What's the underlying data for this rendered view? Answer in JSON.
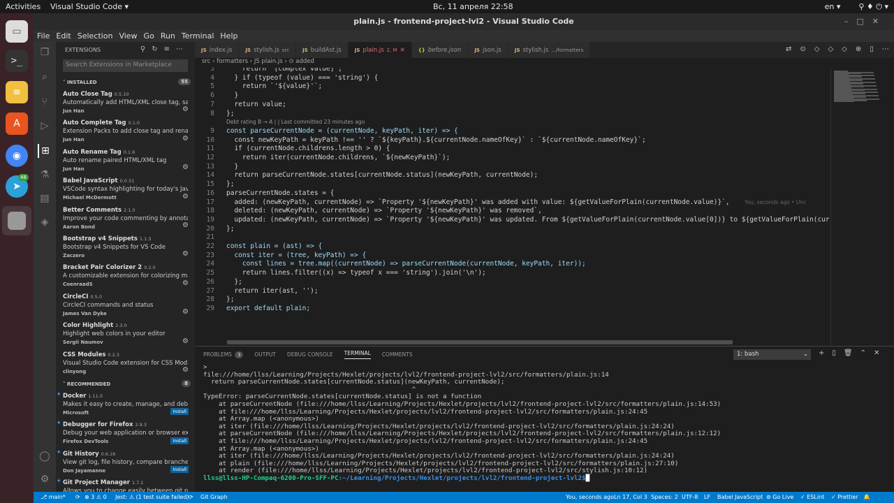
{
  "topbar": {
    "activities": "Activities",
    "app": "Visual Studio Code ▾",
    "clock": "Вс, 11 апреля  22:58",
    "lang": "en ▾",
    "sys": "⚲  ♦  ⏻ ▾"
  },
  "window": {
    "title": "plain.js - frontend-project-lvl2 - Visual Studio Code"
  },
  "menu": [
    "File",
    "Edit",
    "Selection",
    "View",
    "Go",
    "Run",
    "Terminal",
    "Help"
  ],
  "sidebar": {
    "header": "EXTENSIONS",
    "search_placeholder": "Search Extensions in Marketplace",
    "installed_label": "INSTALLED",
    "installed_count": "55",
    "recommended_label": "RECOMMENDED",
    "recommended_count": "8",
    "installed": [
      {
        "name": "Auto Close Tag",
        "version": "0.5.10",
        "desc": "Automatically add HTML/XML close tag, sa...",
        "author": "Jun Han"
      },
      {
        "name": "Auto Complete Tag",
        "version": "0.1.0",
        "desc": "Extension Packs to add close tag and renam...",
        "author": "Jun Han"
      },
      {
        "name": "Auto Rename Tag",
        "version": "0.1.6",
        "desc": "Auto rename paired HTML/XML tag",
        "author": "Jun Han"
      },
      {
        "name": "Babel JavaScript",
        "version": "0.0.31",
        "desc": "VSCode syntax highlighting for today's Java...",
        "author": "Michael McDermott"
      },
      {
        "name": "Better Comments",
        "version": "2.1.0",
        "desc": "Improve your code commenting by annotati...",
        "author": "Aaron Bond"
      },
      {
        "name": "Bootstrap v4 Snippets",
        "version": "1.1.3",
        "desc": "Bootstrap v4 Snippets for VS Code",
        "author": "Zaczero"
      },
      {
        "name": "Bracket Pair Colorizer 2",
        "version": "0.2.0",
        "desc": "A customizable extension for colorizing ma...",
        "author": "CoenraadS"
      },
      {
        "name": "CircleCI",
        "version": "0.5.0",
        "desc": "CircleCI commands and status",
        "author": "James Van Dyke"
      },
      {
        "name": "Color Highlight",
        "version": "2.3.0",
        "desc": "Highlight web colors in your editor",
        "author": "Sergii Naumov"
      },
      {
        "name": "CSS Modules",
        "version": "0.2.3",
        "desc": "Visual Studio Code extension for CSS Modu...",
        "author": "clinyong"
      }
    ],
    "recommended": [
      {
        "name": "Docker",
        "version": "1.11.0",
        "desc": "Makes it easy to create, manage, and debug...",
        "author": "Microsoft",
        "install": "Install"
      },
      {
        "name": "Debugger for Firefox",
        "version": "2.9.3",
        "desc": "Debug your web application or browser ext...",
        "author": "Firefox DevTools",
        "install": "Install"
      },
      {
        "name": "Git History",
        "version": "0.6.16",
        "desc": "View git log, file history, compare branches ...",
        "author": "Don Jayamanne",
        "install": "Install"
      },
      {
        "name": "Git Project Manager",
        "version": "1.7.1",
        "desc": "Allows you to change easily between git pr...",
        "author": "",
        "install": ""
      }
    ]
  },
  "tabs": [
    {
      "label": "index.js",
      "note": ""
    },
    {
      "label": "stylish.js",
      "note": "src"
    },
    {
      "label": "buildAst.js",
      "note": ""
    },
    {
      "label": "plain.js",
      "note": "2, M"
    },
    {
      "label": "before.json",
      "note": ""
    },
    {
      "label": "json.js",
      "note": ""
    },
    {
      "label": "stylish.js",
      "note": ".../formatters"
    }
  ],
  "breadcrumb": "src › formatters › JS plain.js › ⊙ added",
  "editor": {
    "codelens": "Debt rating B → A | | Last committed 23 minutes ago",
    "blame": "You, seconds ago • Unc",
    "lines": [
      {
        "n": "3",
        "t": "    return '[complex value]';"
      },
      {
        "n": "4",
        "t": "  } if (typeof (value) === 'string') {"
      },
      {
        "n": "5",
        "t": "    return `'${value}'`;"
      },
      {
        "n": "6",
        "t": "  }"
      },
      {
        "n": "7",
        "t": "  return value;"
      },
      {
        "n": "8",
        "t": "};"
      },
      {
        "n": "9",
        "t": "const parseCurrentNode = (currentNode, keyPath, iter) => {"
      },
      {
        "n": "10",
        "t": "  const newKeyPath = keyPath !== '' ? `${keyPath}.${currentNode.nameOfKey}` : `${currentNode.nameOfKey}`;"
      },
      {
        "n": "11",
        "t": "  if (currentNode.childrens.length > 0) {"
      },
      {
        "n": "12",
        "t": "    return iter(currentNode.childrens, `${newKeyPath}`);"
      },
      {
        "n": "13",
        "t": "  }"
      },
      {
        "n": "14",
        "t": "  return parseCurrentNode.states[currentNode.status](newKeyPath, currentNode);"
      },
      {
        "n": "15",
        "t": "};"
      },
      {
        "n": "16",
        "t": "parseCurrentNode.states = {"
      },
      {
        "n": "17",
        "t": "  added: (newKeyPath, currentNode) => `Property '${newKeyPath}' was added with value: ${getValueForPlain(currentNode.value)}`,"
      },
      {
        "n": "18",
        "t": "  deleted: (newKeyPath, currentNode) => `Property '${newKeyPath}' was removed`,"
      },
      {
        "n": "19",
        "t": "  updated: (newKeyPath, currentNode) => `Property '${newKeyPath}' was updated. From ${getValueForPlain(currentNode.value[0])} to ${getValueForPlain(curren"
      },
      {
        "n": "20",
        "t": "};"
      },
      {
        "n": "21",
        "t": ""
      },
      {
        "n": "22",
        "t": "const plain = (ast) => {"
      },
      {
        "n": "23",
        "t": "  const iter = (tree, keyPath) => {"
      },
      {
        "n": "24",
        "t": "    const lines = tree.map((currentNode) => parseCurrentNode(currentNode, keyPath, iter));"
      },
      {
        "n": "25",
        "t": "    return lines.filter((x) => typeof x === 'string').join('\\n');"
      },
      {
        "n": "26",
        "t": "  };"
      },
      {
        "n": "27",
        "t": "  return iter(ast, '');"
      },
      {
        "n": "28",
        "t": "};"
      },
      {
        "n": "29",
        "t": "export default plain;"
      }
    ]
  },
  "panel": {
    "tabs": [
      "PROBLEMS",
      "OUTPUT",
      "DEBUG CONSOLE",
      "TERMINAL",
      "COMMENTS"
    ],
    "problems_count": "3",
    "active_tab": "TERMINAL",
    "terminal_select": "1: bash",
    "lines": [
      ">",
      "file:///home/llss/Learning/Projects/Hexlet/projects/lvl2/frontend-project-lvl2/src/formatters/plain.js:14",
      "  return parseCurrentNode.states[currentNode.status](newKeyPath, currentNode);",
      "                                                      ^",
      "",
      "TypeError: parseCurrentNode.states[currentNode.status] is not a function",
      "    at parseCurrentNode (file:///home/llss/Learning/Projects/Hexlet/projects/lvl2/frontend-project-lvl2/src/formatters/plain.js:14:53)",
      "    at file:///home/llss/Learning/Projects/Hexlet/projects/lvl2/frontend-project-lvl2/src/formatters/plain.js:24:45",
      "    at Array.map (<anonymous>)",
      "    at iter (file:///home/llss/Learning/Projects/Hexlet/projects/lvl2/frontend-project-lvl2/src/formatters/plain.js:24:24)",
      "    at parseCurrentNode (file:///home/llss/Learning/Projects/Hexlet/projects/lvl2/frontend-project-lvl2/src/formatters/plain.js:12:12)",
      "    at file:///home/llss/Learning/Projects/Hexlet/projects/lvl2/frontend-project-lvl2/src/formatters/plain.js:24:45",
      "    at Array.map (<anonymous>)",
      "    at iter (file:///home/llss/Learning/Projects/Hexlet/projects/lvl2/frontend-project-lvl2/src/formatters/plain.js:24:24)",
      "    at plain (file:///home/llss/Learning/Projects/Hexlet/projects/lvl2/frontend-project-lvl2/src/formatters/plain.js:27:10)",
      "    at render (file:///home/llss/Learning/Projects/Hexlet/projects/lvl2/frontend-project-lvl2/src/stylish.js:10:12)"
    ],
    "prompt_user": "llss@llss-HP-Compaq-6200-Pro-SFF-PC",
    "prompt_path": ":~/Learning/Projects/Hexlet/projects/lvl2/frontend-project-lvl2$"
  },
  "status": {
    "branch": "⎇ main*",
    "sync": "⟳",
    "problems": "⊗ 3 ⚠ 0",
    "jest": "Jest: ⚠ (1 test suite failed)",
    "jest_icon": "⟳",
    "gitgraph": "Git Graph",
    "blame": "You, seconds ago",
    "pos": "Ln 17, Col 3",
    "spaces": "Spaces: 2",
    "enc": "UTF-8",
    "eol": "LF",
    "lang": "Babel JavaScript",
    "golive": "⊚ Go Live",
    "eslint": "✓ ESLint",
    "prettier": "✓ Prettier",
    "bell": "🔔"
  },
  "dock_badge": "48"
}
